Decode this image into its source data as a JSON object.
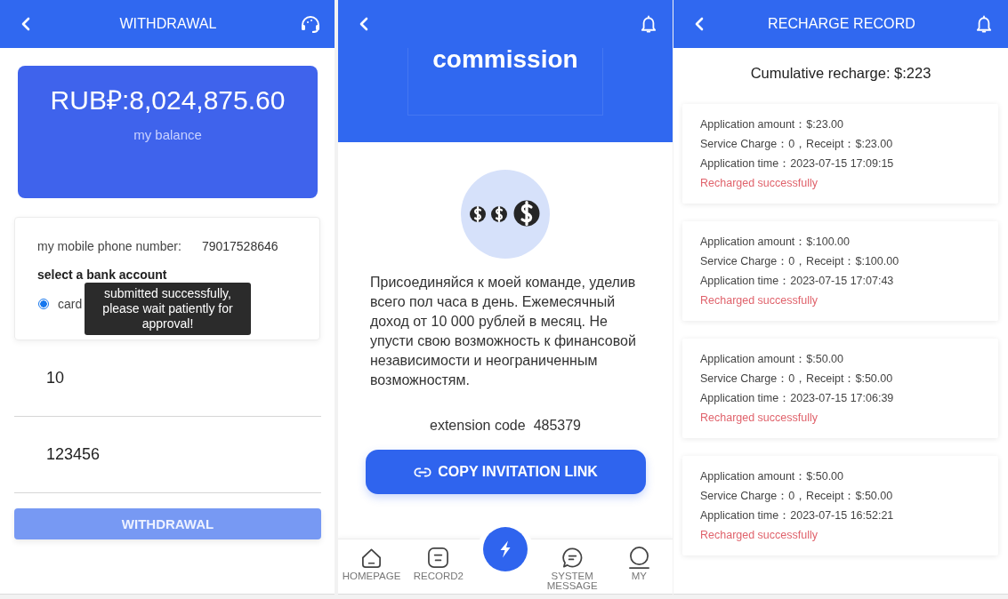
{
  "withdrawal": {
    "header": {
      "title": "WITHDRAWAL"
    },
    "balance": {
      "amount": "RUB₽:8,024,875.60",
      "label": "my balance"
    },
    "account": {
      "phone_label": "my mobile phone number:",
      "phone": "79017528646",
      "bank_label": "select a bank account",
      "options": [
        {
          "label": "card",
          "selected": true
        }
      ]
    },
    "fields": [
      {
        "value": "10"
      },
      {
        "value": "123456"
      }
    ],
    "submit": {
      "label": "WITHDRAWAL",
      "disabled": true
    },
    "toast": "submitted successfully, please wait patiently for approval!"
  },
  "invitation": {
    "banner": {
      "title": "commission"
    },
    "message": "Присоединяйся к моей команде, уделив всего пол часа в день. Ежемесячный доход от 10 000 рублей в месяц. Не упусти свою возможность к финансовой независимости и неограниченным возможностям.",
    "extension": {
      "label": "extension code",
      "value": "485379"
    },
    "copy_button": "COPY INVITATION LINK",
    "nav": [
      {
        "kind": "home",
        "label": "HOMEPAGE",
        "selected": false
      },
      {
        "kind": "record",
        "label": "RECORD2",
        "selected": false
      },
      {
        "kind": "message",
        "label": "SYSTEM MESSAGE",
        "selected": false
      },
      {
        "kind": "profile",
        "label": "MY",
        "selected": false
      }
    ]
  },
  "recharge": {
    "header": {
      "title": "RECHARGE RECORD"
    },
    "total": "Cumulative recharge: $:223",
    "records": [
      {
        "amount": "Application amount：$:23.00",
        "charge": "Service Charge：0，Receipt：$:23.00",
        "time": "Application time：2023-07-15 17:09:15",
        "status": "Recharged successfully"
      },
      {
        "amount": "Application amount：$:100.00",
        "charge": "Service Charge：0，Receipt：$:100.00",
        "time": "Application time：2023-07-15 17:07:43",
        "status": "Recharged successfully"
      },
      {
        "amount": "Application amount：$:50.00",
        "charge": "Service Charge：0，Receipt：$:50.00",
        "time": "Application time：2023-07-15 17:06:39",
        "status": "Recharged successfully"
      },
      {
        "amount": "Application amount：$:50.00",
        "charge": "Service Charge：0，Receipt：$:50.00",
        "time": "Application time：2023-07-15 16:52:21",
        "status": "Recharged successfully"
      }
    ]
  }
}
